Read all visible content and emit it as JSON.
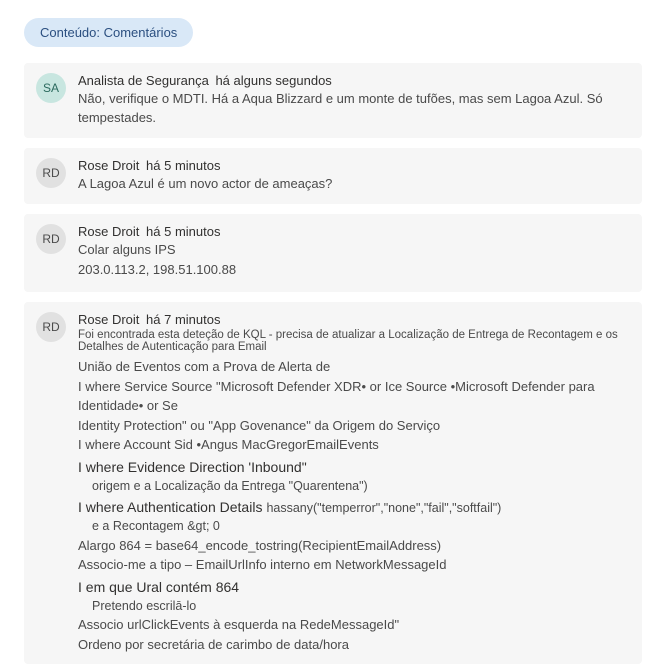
{
  "tab": {
    "label": "Conteúdo: Comentários"
  },
  "comments": [
    {
      "initials": "SA",
      "author": "Analista de Segurança",
      "time": "há alguns segundos",
      "body": "Não, verifique o MDTI. Há a Aqua Blizzard e um monte de tufões, mas sem Lagoa Azul. Só tempestades."
    },
    {
      "initials": "RD",
      "author": "Rose Droit",
      "time": "há 5 minutos",
      "body": "A Lagoa Azul é um novo actor de ameaças?"
    },
    {
      "initials": "RD",
      "author": "Rose Droit",
      "time": "há 5 minutos",
      "body_lines": [
        "Colar alguns IPS",
        "203.0.113.2, 198.51.100.88"
      ]
    },
    {
      "initials": "RD",
      "author": "Rose Droit",
      "time": "há 7 minutos",
      "subtitle": "Foi encontrada esta deteção de KQL - precisa de atualizar a Localização de Entrega de Recontagem e os Detalhes de Autenticação para Email",
      "kql": [
        {
          "t": "line",
          "v": "União de Eventos com a Prova de Alerta de"
        },
        {
          "t": "line",
          "v": "I where Service Source \"Microsoft Defender XDR• or Ice Source •Microsoft Defender para Identidade• or Se"
        },
        {
          "t": "line",
          "v": "Identity Protection\" ou \"App Govenance\" da Origem do Serviço"
        },
        {
          "t": "line",
          "v": "I where Account Sid •Angus MacGregorEmailEvents"
        },
        {
          "t": "head",
          "v": "I where Evidence Direction 'Inbound\""
        },
        {
          "t": "sub",
          "v": "origem e a Localização da Entrega \"Quarentena\")"
        },
        {
          "t": "head_with_trail",
          "v": "I where Authentication Details",
          "trail": "hassany(\"temperror\",\"none\",\"fail\",\"softfail\")"
        },
        {
          "t": "sub",
          "v": "e a Recontagem &gt; 0"
        },
        {
          "t": "line",
          "v": "Alargo 864 = base64_encode_tostring(RecipientEmailAddress)"
        },
        {
          "t": "line",
          "v": "Associo-me a tipo – EmailUrlInfo interno em NetworkMessageId"
        },
        {
          "t": "head",
          "v": "I em que Ural contém 864"
        },
        {
          "t": "sub",
          "v": "Pretendo escrilā-lo"
        },
        {
          "t": "line",
          "v": "Associo urlClickEvents à esquerda na RedeMessageId\""
        },
        {
          "t": "line",
          "v": "Ordeno por secretária de carimbo de data/hora"
        }
      ]
    }
  ]
}
